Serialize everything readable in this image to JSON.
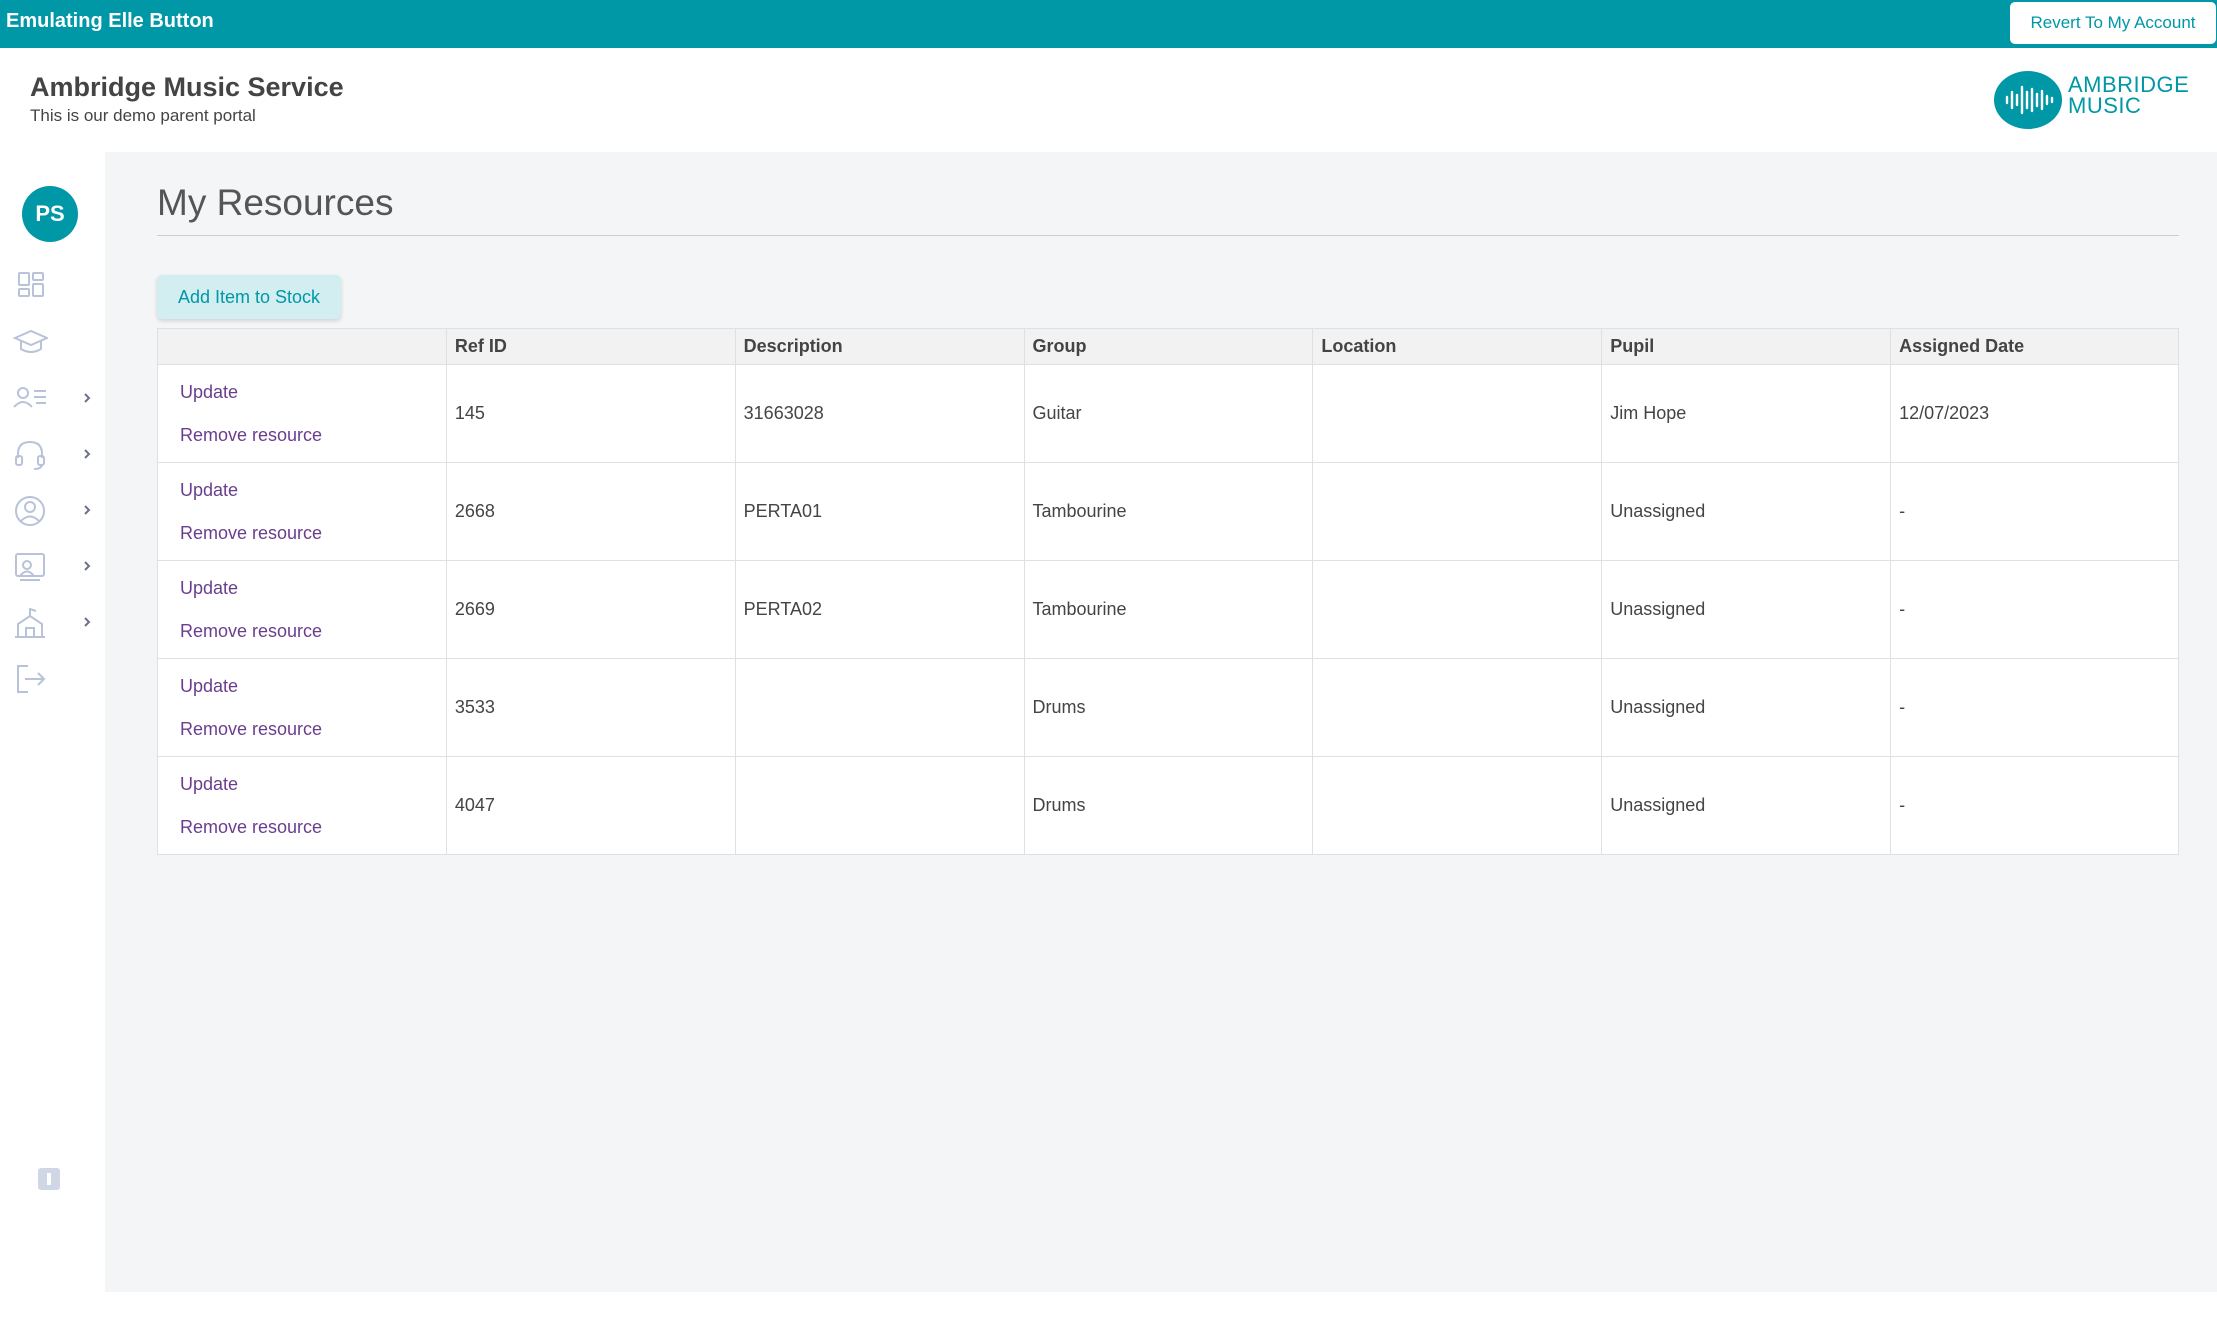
{
  "banner": {
    "text": "Emulating Elle Button",
    "revert_label": "Revert To My Account"
  },
  "header": {
    "title": "Ambridge Music Service",
    "subtitle": "This is our demo parent portal",
    "logo_line1": "AMBRIDGE",
    "logo_line2": "MUSIC"
  },
  "sidebar": {
    "avatar_initials": "PS",
    "items": [
      {
        "icon": "dashboard-icon",
        "has_chevron": false
      },
      {
        "icon": "graduation-cap-icon",
        "has_chevron": false
      },
      {
        "icon": "user-list-icon",
        "has_chevron": true
      },
      {
        "icon": "headset-icon",
        "has_chevron": true
      },
      {
        "icon": "user-circle-icon",
        "has_chevron": true
      },
      {
        "icon": "classroom-icon",
        "has_chevron": true
      },
      {
        "icon": "building-music-icon",
        "has_chevron": true
      },
      {
        "icon": "logout-icon",
        "has_chevron": false
      }
    ]
  },
  "main": {
    "title": "My Resources",
    "add_button": "Add Item to Stock",
    "table": {
      "headers": [
        "",
        "Ref ID",
        "Description",
        "Group",
        "Location",
        "Pupil",
        "Assigned Date"
      ],
      "update_label": "Update",
      "remove_label": "Remove resource",
      "rows": [
        {
          "ref_id": "145",
          "description": "31663028",
          "group": "Guitar",
          "location": "",
          "pupil": "Jim Hope",
          "assigned_date": "12/07/2023"
        },
        {
          "ref_id": "2668",
          "description": "PERTA01",
          "group": "Tambourine",
          "location": "",
          "pupil": "Unassigned",
          "assigned_date": "-"
        },
        {
          "ref_id": "2669",
          "description": "PERTA02",
          "group": "Tambourine",
          "location": "",
          "pupil": "Unassigned",
          "assigned_date": "-"
        },
        {
          "ref_id": "3533",
          "description": "",
          "group": "Drums",
          "location": "",
          "pupil": "Unassigned",
          "assigned_date": "-"
        },
        {
          "ref_id": "4047",
          "description": "",
          "group": "Drums",
          "location": "",
          "pupil": "Unassigned",
          "assigned_date": "-"
        }
      ]
    }
  },
  "colors": {
    "accent": "#0097a7",
    "link": "#6a3d8f",
    "icon_muted": "#b8c2d8"
  }
}
